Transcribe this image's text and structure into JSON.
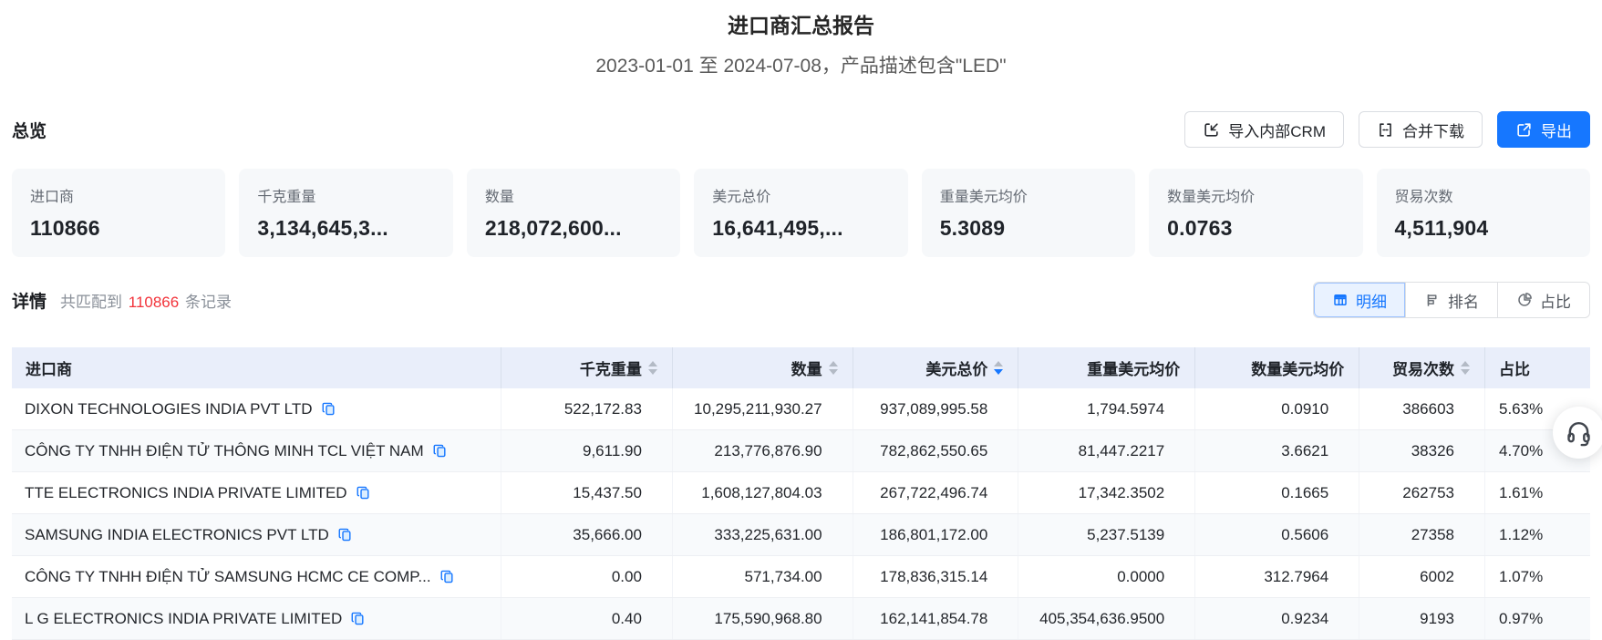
{
  "page": {
    "title": "进口商汇总报告",
    "subtitle": "2023-01-01 至 2024-07-08，产品描述包含\"LED\""
  },
  "overview": {
    "heading": "总览",
    "buttons": {
      "import_crm": "导入内部CRM",
      "merge_download": "合并下载",
      "export": "导出"
    },
    "cards": [
      {
        "label": "进口商",
        "value": "110866"
      },
      {
        "label": "千克重量",
        "value": "3,134,645,3..."
      },
      {
        "label": "数量",
        "value": "218,072,600..."
      },
      {
        "label": "美元总价",
        "value": "16,641,495,..."
      },
      {
        "label": "重量美元均价",
        "value": "5.3089"
      },
      {
        "label": "数量美元均价",
        "value": "0.0763"
      },
      {
        "label": "贸易次数",
        "value": "4,511,904"
      }
    ]
  },
  "detail": {
    "heading": "详情",
    "match_prefix": "共匹配到",
    "match_count": "110866",
    "match_suffix": "条记录",
    "tabs": [
      {
        "label": "明细",
        "active": true
      },
      {
        "label": "排名",
        "active": false
      },
      {
        "label": "占比",
        "active": false
      }
    ]
  },
  "table": {
    "columns": [
      {
        "label": "进口商",
        "align": "left",
        "sortable": false
      },
      {
        "label": "千克重量",
        "align": "right",
        "sortable": true,
        "sort": null
      },
      {
        "label": "数量",
        "align": "right",
        "sortable": true,
        "sort": null
      },
      {
        "label": "美元总价",
        "align": "right",
        "sortable": true,
        "sort": "desc"
      },
      {
        "label": "重量美元均价",
        "align": "right",
        "sortable": false
      },
      {
        "label": "数量美元均价",
        "align": "right",
        "sortable": false
      },
      {
        "label": "贸易次数",
        "align": "right",
        "sortable": true,
        "sort": null
      },
      {
        "label": "占比",
        "align": "left",
        "sortable": false
      }
    ],
    "rows": [
      [
        "DIXON TECHNOLOGIES INDIA PVT LTD",
        "522,172.83",
        "10,295,211,930.27",
        "937,089,995.58",
        "1,794.5974",
        "0.0910",
        "386603",
        "5.63%"
      ],
      [
        "CÔNG TY TNHH ĐIỆN TỬ THÔNG MINH TCL VIỆT NAM",
        "9,611.90",
        "213,776,876.90",
        "782,862,550.65",
        "81,447.2217",
        "3.6621",
        "38326",
        "4.70%"
      ],
      [
        "TTE ELECTRONICS INDIA PRIVATE LIMITED",
        "15,437.50",
        "1,608,127,804.03",
        "267,722,496.74",
        "17,342.3502",
        "0.1665",
        "262753",
        "1.61%"
      ],
      [
        "SAMSUNG INDIA ELECTRONICS PVT LTD",
        "35,666.00",
        "333,225,631.00",
        "186,801,172.00",
        "5,237.5139",
        "0.5606",
        "27358",
        "1.12%"
      ],
      [
        "CÔNG TY TNHH ĐIỆN TỬ SAMSUNG HCMC CE COMP...",
        "0.00",
        "571,734.00",
        "178,836,315.14",
        "0.0000",
        "312.7964",
        "6002",
        "1.07%"
      ],
      [
        "L G ELECTRONICS INDIA PRIVATE LIMITED",
        "0.40",
        "175,590,968.80",
        "162,141,854.78",
        "405,354,636.9500",
        "0.9234",
        "9193",
        "0.97%"
      ]
    ]
  },
  "colors": {
    "accent_blue": "#1677ff",
    "record_count_red": "#f2333a",
    "table_header_bg": "#e9eefa",
    "card_bg": "#f6f8fa"
  }
}
